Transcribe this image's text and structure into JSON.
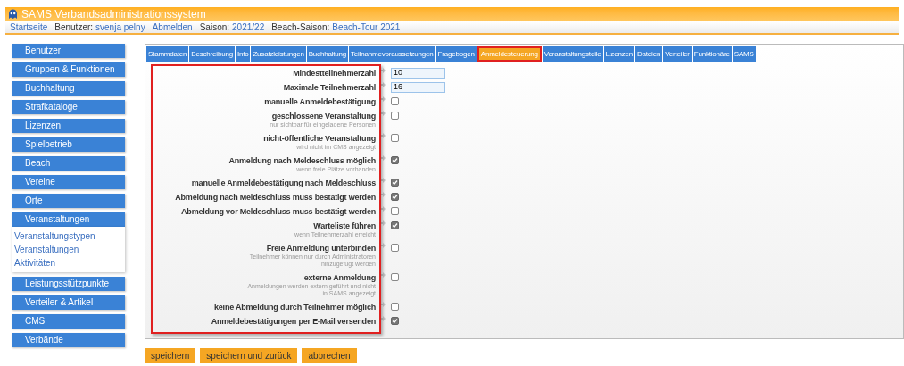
{
  "app_title": "SAMS Verbandsadministrationssystem",
  "nav": [
    {
      "kind": "link",
      "text": "Startseite"
    },
    {
      "kind": "pair",
      "label": "Benutzer:",
      "value": "svenja pelny"
    },
    {
      "kind": "link",
      "text": "Abmelden"
    },
    {
      "kind": "pair",
      "label": "Saison:",
      "value": "2021/22"
    },
    {
      "kind": "pair",
      "label": "Beach-Saison:",
      "value": "Beach-Tour 2021"
    }
  ],
  "sidebar": {
    "items": [
      {
        "label": "Benutzer"
      },
      {
        "label": "Gruppen & Funktionen"
      },
      {
        "label": "Buchhaltung"
      },
      {
        "label": "Strafkataloge"
      },
      {
        "label": "Lizenzen"
      },
      {
        "label": "Spielbetrieb"
      },
      {
        "label": "Beach"
      },
      {
        "label": "Vereine"
      },
      {
        "label": "Orte"
      },
      {
        "label": "Veranstaltungen",
        "children": [
          "Veranstaltungstypen",
          "Veranstaltungen",
          "Aktivitäten"
        ]
      },
      {
        "label": "Leistungsstützpunkte"
      },
      {
        "label": "Verteiler & Artikel"
      },
      {
        "label": "CMS"
      },
      {
        "label": "Verbände"
      }
    ]
  },
  "tabs": [
    {
      "label": "Stammdaten",
      "selected": false
    },
    {
      "label": "Beschreibung",
      "selected": false
    },
    {
      "label": "Info",
      "selected": false
    },
    {
      "label": "Zusatzleistungen",
      "selected": false
    },
    {
      "label": "Buchhaltung",
      "selected": false
    },
    {
      "label": "Teilnahmevoraussetzungen",
      "selected": false
    },
    {
      "label": "Fragebogen",
      "selected": false
    },
    {
      "label": "Anmeldesteuerung",
      "selected": true
    },
    {
      "label": "Veranstaltungsteile",
      "selected": false
    },
    {
      "label": "Lizenzen",
      "selected": false
    },
    {
      "label": "Dateien",
      "selected": false
    },
    {
      "label": "Verteiler",
      "selected": false
    },
    {
      "label": "Funktionäre",
      "selected": false
    },
    {
      "label": "SAMS",
      "selected": false
    }
  ],
  "form": [
    {
      "kind": "number",
      "label": "Mindestteilnehmerzahl",
      "value": "10"
    },
    {
      "kind": "number",
      "label": "Maximale Teilnehmerzahl",
      "value": "16"
    },
    {
      "kind": "checkbox",
      "label": "manuelle Anmeldebestätigung",
      "checked": false
    },
    {
      "kind": "checkbox",
      "label": "geschlossene Veranstaltung",
      "hint": "nur sichtbar für eingeladene Personen",
      "checked": false
    },
    {
      "kind": "checkbox",
      "label": "nicht-öffentliche Veranstaltung",
      "hint": "wird nicht im CMS angezeigt",
      "checked": false
    },
    {
      "kind": "checkbox",
      "label": "Anmeldung nach Meldeschluss möglich",
      "hint": "wenn freie Plätze vorhanden",
      "checked": true
    },
    {
      "kind": "checkbox",
      "label": "manuelle Anmeldebestätigung nach Meldeschluss",
      "checked": true
    },
    {
      "kind": "checkbox",
      "label": "Abmeldung nach Meldeschluss muss bestätigt werden",
      "checked": true
    },
    {
      "kind": "checkbox",
      "label": "Abmeldung vor Meldeschluss muss bestätigt werden",
      "checked": false
    },
    {
      "kind": "checkbox",
      "label": "Warteliste führen",
      "hint": "wenn Teilnehmerzahl erreicht",
      "checked": true
    },
    {
      "kind": "checkbox",
      "label": "Freie Anmeldung unterbinden",
      "hint": "Teilnehmer können nur durch Administratoren hinzugefügt werden",
      "checked": false
    },
    {
      "kind": "checkbox",
      "label": "externe Anmeldung",
      "hint": "Anmeldungen werden extern geführt und nicht in SAMS angezeigt",
      "checked": false
    },
    {
      "kind": "checkbox",
      "label": "keine Abmeldung durch Teilnehmer möglich",
      "checked": false
    },
    {
      "kind": "checkbox",
      "label": "Anmeldebestätigungen per E-Mail versenden",
      "checked": true
    }
  ],
  "buttons": [
    "speichern",
    "speichern und zurück",
    "abbrechen"
  ]
}
